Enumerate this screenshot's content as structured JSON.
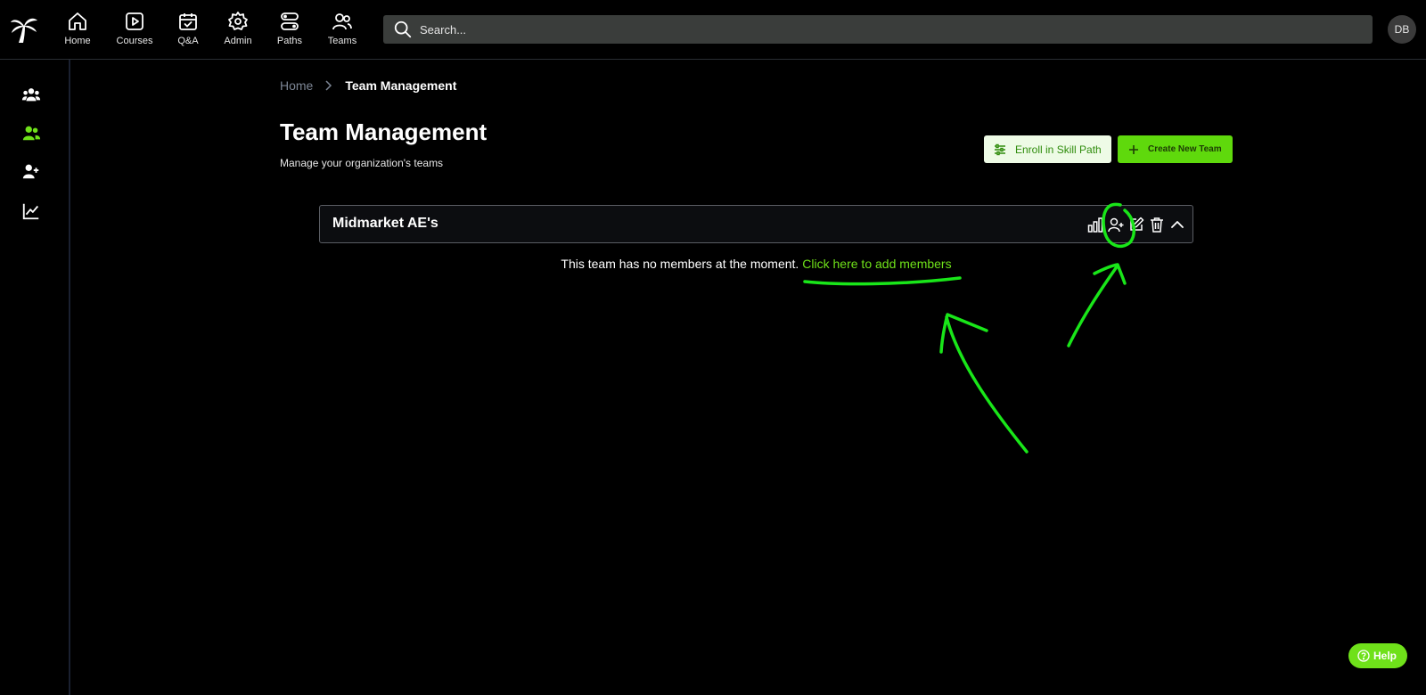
{
  "nav": {
    "items": [
      {
        "label": "Home",
        "icon": "home-icon"
      },
      {
        "label": "Courses",
        "icon": "play-icon"
      },
      {
        "label": "Q&A",
        "icon": "calendar-check-icon"
      },
      {
        "label": "Admin",
        "icon": "gear-icon"
      },
      {
        "label": "Paths",
        "icon": "paths-icon"
      },
      {
        "label": "Teams",
        "icon": "users-icon"
      }
    ]
  },
  "search": {
    "placeholder": "Search..."
  },
  "user": {
    "initials": "DB"
  },
  "sidebar": {
    "items": [
      {
        "icon": "groups-icon",
        "active": false
      },
      {
        "icon": "team-users-icon",
        "active": true
      },
      {
        "icon": "user-plus-icon",
        "active": false
      },
      {
        "icon": "line-chart-icon",
        "active": false
      }
    ]
  },
  "breadcrumb": {
    "home": "Home",
    "current": "Team Management"
  },
  "page": {
    "title": "Team Management",
    "subtitle": "Manage your organization's teams"
  },
  "actions": {
    "enroll_label": "Enroll in Skill Path",
    "create_label": "Create New Team"
  },
  "team": {
    "name": "Midmarket AE's",
    "empty_message": "This team has no members at the moment.",
    "add_link": "Click here to add members"
  },
  "help": {
    "label": "Help"
  },
  "colors": {
    "accent": "#6fe11a",
    "button_green": "#5fd90c",
    "annotation": "#19e619",
    "background": "#000000"
  }
}
